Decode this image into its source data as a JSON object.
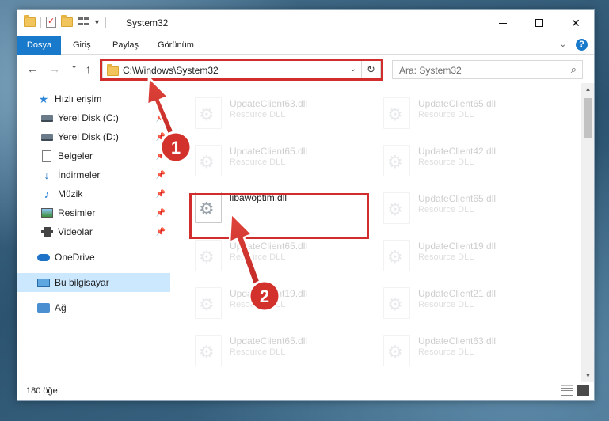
{
  "window": {
    "title": "System32",
    "controls": {
      "minimize": "—",
      "maximize": "□",
      "close": "✕"
    }
  },
  "ribbon": {
    "tabs": [
      "Dosya",
      "Giriş",
      "Paylaş",
      "Görünüm"
    ],
    "help": "?"
  },
  "nav": {
    "back": "←",
    "forward": "→",
    "recent": "⌄",
    "up": "↑",
    "address": "C:\\Windows\\System32",
    "refresh": "↻",
    "search_placeholder": "Ara: System32",
    "search_icon": "⌕"
  },
  "sidebar": {
    "items": [
      {
        "label": "Hızlı erişim",
        "icon": "star-icon",
        "pinned": false
      },
      {
        "label": "Yerel Disk (C:)",
        "icon": "drive-icon",
        "pinned": true
      },
      {
        "label": "Yerel Disk (D:)",
        "icon": "drive-icon",
        "pinned": true
      },
      {
        "label": "Belgeler",
        "icon": "document-icon",
        "pinned": true
      },
      {
        "label": "İndirmeler",
        "icon": "download-icon",
        "pinned": true
      },
      {
        "label": "Müzik",
        "icon": "music-icon",
        "pinned": true
      },
      {
        "label": "Resimler",
        "icon": "pictures-icon",
        "pinned": true
      },
      {
        "label": "Videolar",
        "icon": "video-icon",
        "pinned": true
      },
      {
        "label": "OneDrive",
        "icon": "cloud-icon",
        "pinned": false
      },
      {
        "label": "Bu bilgisayar",
        "icon": "computer-icon",
        "pinned": false,
        "selected": true
      },
      {
        "label": "Ağ",
        "icon": "network-icon",
        "pinned": false
      }
    ]
  },
  "files": {
    "left": [
      {
        "name": "UpdateClient63.dll",
        "type": "Resource DLL"
      },
      {
        "name": "UpdateClient65.dll",
        "type": "Resource DLL"
      },
      {
        "name": "libawoptim.dll",
        "type": "",
        "highlighted": true
      },
      {
        "name": "UpdateClient65.dll",
        "type": "Resource DLL"
      },
      {
        "name": "UpdateClient19.dll",
        "type": "Resource DLL"
      },
      {
        "name": "UpdateClient65.dll",
        "type": "Resource DLL"
      }
    ],
    "right": [
      {
        "name": "UpdateClient65.dll",
        "type": "Resource DLL"
      },
      {
        "name": "UpdateClient42.dll",
        "type": "Resource DLL"
      },
      {
        "name": "UpdateClient65.dll",
        "type": "Resource DLL"
      },
      {
        "name": "UpdateClient19.dll",
        "type": "Resource DLL"
      },
      {
        "name": "UpdateClient21.dll",
        "type": "Resource DLL"
      },
      {
        "name": "UpdateClient63.dll",
        "type": "Resource DLL"
      }
    ]
  },
  "status": {
    "count": "180 öğe"
  },
  "annotations": [
    {
      "number": "1"
    },
    {
      "number": "2"
    }
  ],
  "colors": {
    "accent": "#1979ca",
    "highlight_red": "#d22d2d",
    "selection": "#cce8ff"
  }
}
